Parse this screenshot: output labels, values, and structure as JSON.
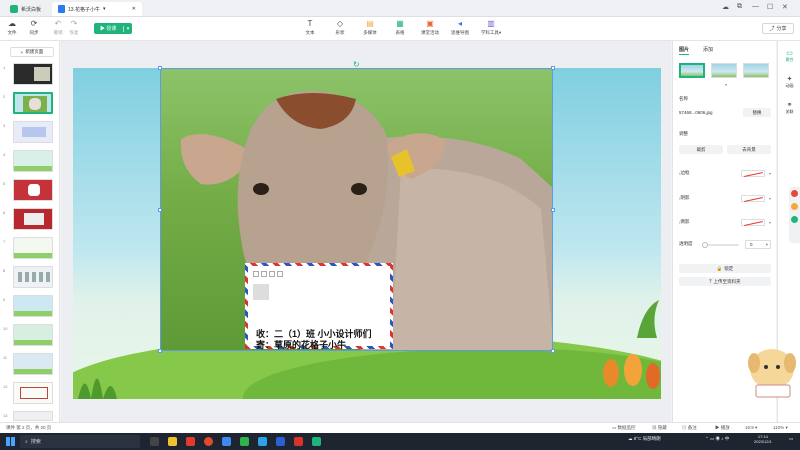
{
  "tabs": [
    {
      "label": "希沃白板"
    },
    {
      "label": "13.花格子小牛",
      "chevron": "▾"
    }
  ],
  "toolbar": {
    "left": [
      {
        "label": "文件",
        "icon": "cloud-icon"
      },
      {
        "label": "同步",
        "icon": "sync-icon"
      },
      {
        "label": "撤销",
        "icon": "undo-icon"
      },
      {
        "label": "恢复",
        "icon": "redo-icon"
      }
    ],
    "play_label": "授课",
    "center": [
      {
        "label": "文本",
        "icon": "T"
      },
      {
        "label": "形状",
        "icon": "◇"
      },
      {
        "label": "多媒体",
        "icon": "▤"
      },
      {
        "label": "表格",
        "icon": "▦"
      },
      {
        "label": "课堂活动",
        "icon": "▣"
      },
      {
        "label": "思维导图",
        "icon": "◂"
      },
      {
        "label": "学科工具",
        "icon": "▥"
      }
    ],
    "share_label": "分享"
  },
  "left_panel": {
    "new_page_label": "新建页面",
    "thumbs": [
      "1",
      "2",
      "3",
      "4",
      "5",
      "6",
      "7",
      "8",
      "9",
      "10",
      "11",
      "12",
      "13"
    ]
  },
  "slide": {
    "card_line1": "收：二（1）班 小小设计师们",
    "card_line2": "寄：草原的花格子小牛"
  },
  "right_panel": {
    "tab_image": "图片",
    "tab_animation": "添加",
    "name_label": "名称",
    "filename": "57468...0606.jpg",
    "replace_label": "替换",
    "adjust_label": "调整",
    "crop_label": "裁剪",
    "remove_bg_label": "去背景",
    "border_label": "边框",
    "shadow_label": "阴影",
    "reflection_label": "倒影",
    "opacity_label": "透明度",
    "opacity_value": "0",
    "opacity_fraction": 0,
    "lock_label": "锁定",
    "upload_label": "上传至资料夹"
  },
  "side_strip": [
    {
      "label": "属性",
      "icon": "▭"
    },
    {
      "label": "动画",
      "icon": "✦"
    },
    {
      "label": "关联",
      "icon": "⚭"
    }
  ],
  "status_bar": {
    "left": "课件 第 2 页，共 20 页",
    "mid1": "数据监控",
    "mid2": "隐藏",
    "mid3": "备注",
    "mid4": "播放",
    "ratio": "16:9",
    "zoom": "110%"
  },
  "taskbar": {
    "search_placeholder": "搜索",
    "weather": "8°C 局部晴朗",
    "time": "17:14",
    "date": "2023/12/1"
  }
}
